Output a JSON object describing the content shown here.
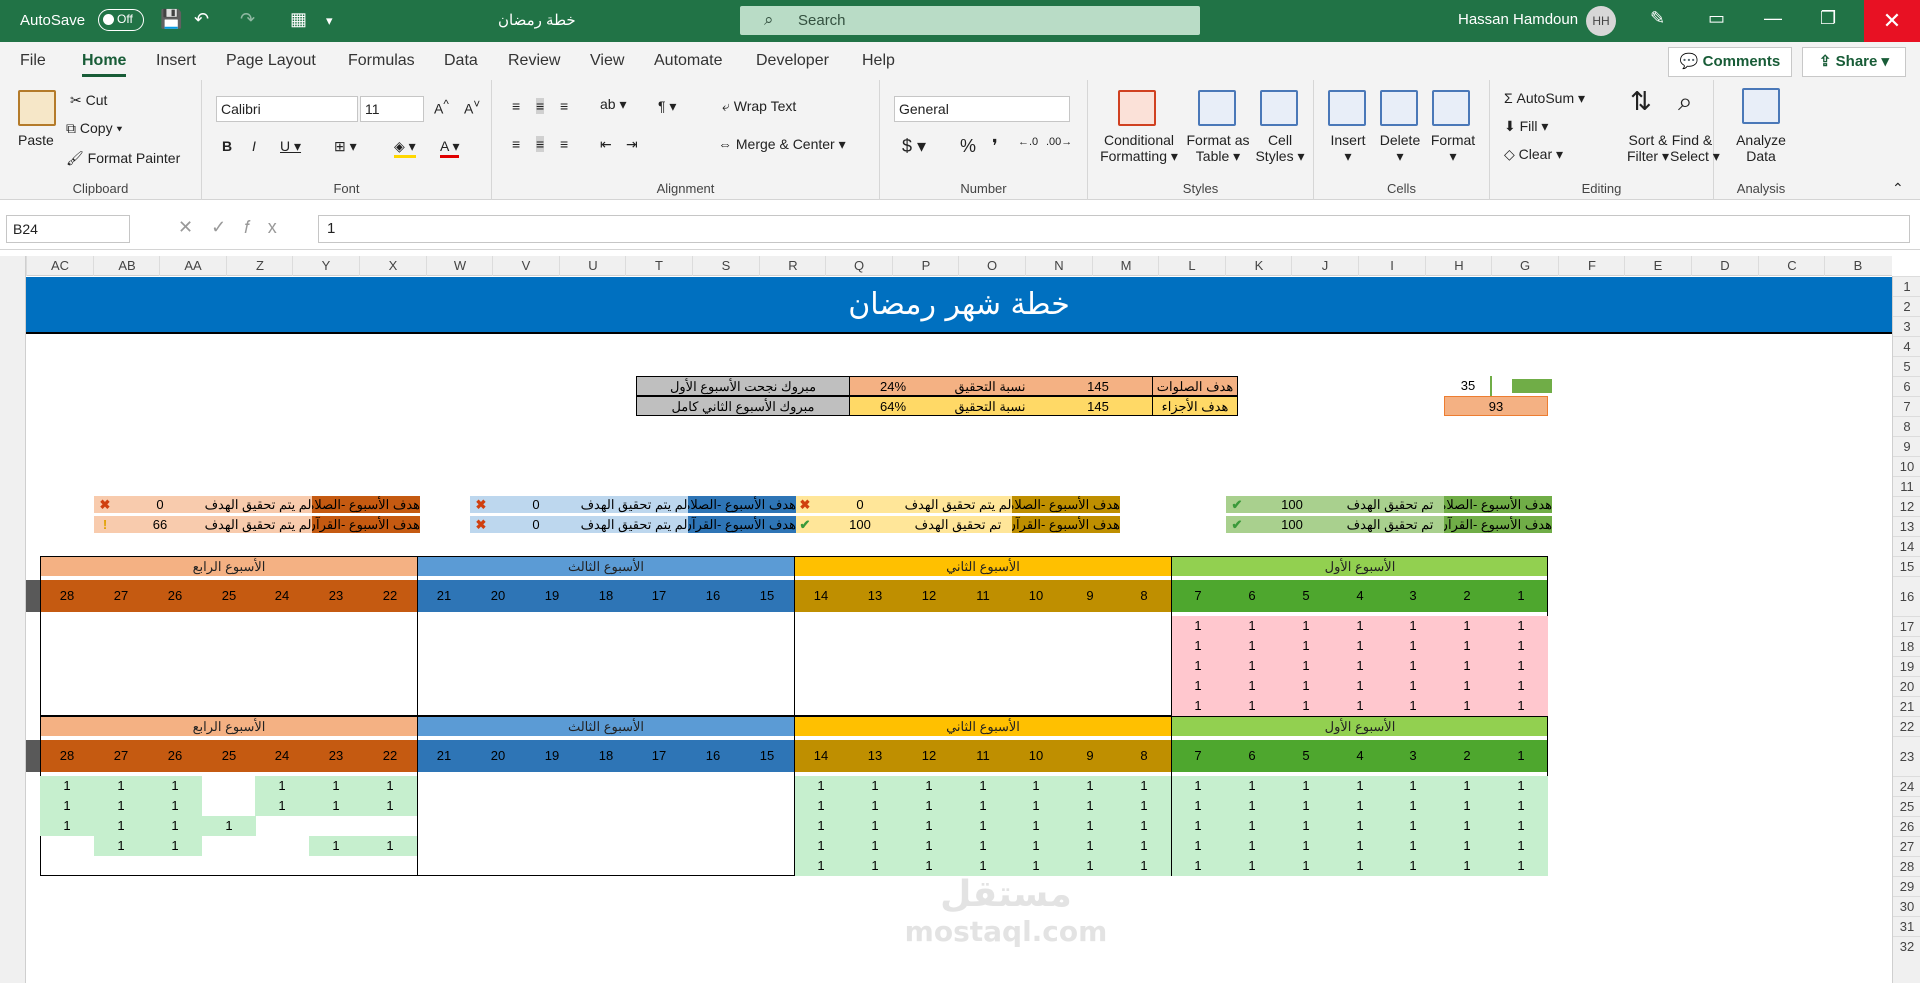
{
  "titlebar": {
    "autosave": "AutoSave",
    "toggle": "Off",
    "doc_title": "خطة رمضان",
    "search": "Search",
    "user": "Hassan Hamdoun",
    "initials": "HH"
  },
  "menu": {
    "items": [
      "File",
      "Home",
      "Insert",
      "Page Layout",
      "Formulas",
      "Data",
      "Review",
      "View",
      "Automate",
      "Developer",
      "Help"
    ],
    "comments": "Comments",
    "share": "Share"
  },
  "ribbon": {
    "paste": "Paste",
    "cut": "Cut",
    "copy": "Copy",
    "format_painter": "Format Painter",
    "clipboard": "Clipboard",
    "font_name": "Calibri",
    "font_size": "11",
    "font": "Font",
    "wrap_text": "Wrap Text",
    "merge_center": "Merge & Center",
    "alignment": "Alignment",
    "number_format": "General",
    "number": "Number",
    "conditional": "Conditional",
    "formatting": "Formatting",
    "format_as": "Format as",
    "table": "Table",
    "cell": "Cell",
    "styles_lbl": "Styles",
    "styles": "Styles",
    "insert": "Insert",
    "delete": "Delete",
    "format": "Format",
    "cells": "Cells",
    "autosum": "AutoSum",
    "fill": "Fill",
    "clear": "Clear",
    "sort": "Sort &",
    "filter": "Filter",
    "find": "Find &",
    "select": "Select",
    "editing": "Editing",
    "analyze": "Analyze",
    "data_lbl": "Data",
    "analysis": "Analysis"
  },
  "formula": {
    "name_box": "B24",
    "value": "1"
  },
  "columns": [
    "AC",
    "AB",
    "AA",
    "Z",
    "Y",
    "X",
    "W",
    "V",
    "U",
    "T",
    "S",
    "R",
    "Q",
    "P",
    "O",
    "N",
    "M",
    "L",
    "K",
    "J",
    "I",
    "H",
    "G",
    "F",
    "E",
    "D",
    "C",
    "B"
  ],
  "rows": [
    "1",
    "2",
    "3",
    "4",
    "5",
    "6",
    "7",
    "8",
    "9",
    "10",
    "11",
    "12",
    "13",
    "14",
    "15",
    "16",
    "17",
    "18",
    "19",
    "20",
    "21",
    "22",
    "23",
    "24",
    "25",
    "26",
    "27",
    "28",
    "29",
    "30",
    "31",
    "32"
  ],
  "sheet": {
    "title": "خطة شهر رمضان",
    "summary": [
      {
        "label": "هدف الصلوات",
        "target": "145",
        "ratio_label": "نسبة التحقيق",
        "ratio": "24%",
        "msg": "مبروك نجحت الأسبوع الأول"
      },
      {
        "label": "هدف الأجزاء",
        "target": "145",
        "ratio_label": "نسبة التحقيق",
        "ratio": "64%",
        "msg": "مبروك الأسبوع الثاني كامل"
      }
    ],
    "small_values": [
      "35",
      "93"
    ],
    "goal_label_prayer": "هدف الأسبوع -الصلاة",
    "goal_label_quran": "هدف الأسبوع -القرآن",
    "achieved": "تم تحقيق الهدف",
    "not_achieved": "لم يتم تحقيق الهدف",
    "goals": [
      {
        "p_status": "تم تحقيق الهدف",
        "p_val": "100",
        "p_icon": "✔",
        "q_status": "تم تحقيق الهدف",
        "q_val": "100",
        "q_icon": "✔"
      },
      {
        "p_status": "لم يتم تحقيق الهدف",
        "p_val": "0",
        "p_icon": "✖",
        "q_status": "تم تحقيق الهدف",
        "q_val": "100",
        "q_icon": "✔"
      },
      {
        "p_status": "لم يتم تحقيق الهدف",
        "p_val": "0",
        "p_icon": "✖",
        "q_status": "لم يتم تحقيق الهدف",
        "q_val": "0",
        "q_icon": "✖"
      },
      {
        "p_status": "لم يتم تحقيق الهدف",
        "p_val": "0",
        "p_icon": "✖",
        "q_status": "لم يتم تحقيق الهدف",
        "q_val": "66",
        "q_icon": "!"
      }
    ],
    "weeks": [
      "الأسبوع الأول",
      "الأسبوع الثاني",
      "الأسبوع الثالث",
      "الأسبوع الرابع"
    ],
    "days": [
      "1",
      "2",
      "3",
      "4",
      "5",
      "6",
      "7",
      "8",
      "9",
      "10",
      "11",
      "12",
      "13",
      "14",
      "15",
      "16",
      "17",
      "18",
      "19",
      "20",
      "21",
      "22",
      "23",
      "24",
      "25",
      "26",
      "27",
      "28"
    ],
    "cell_value": "1",
    "watermark": "مستقل",
    "watermark_url": "mostaql.com"
  },
  "colors": {
    "excel_green": "#217346",
    "week1": "#92d050",
    "week2": "#ffc000",
    "week3": "#5b9bd5",
    "week4": "#f4b183"
  }
}
